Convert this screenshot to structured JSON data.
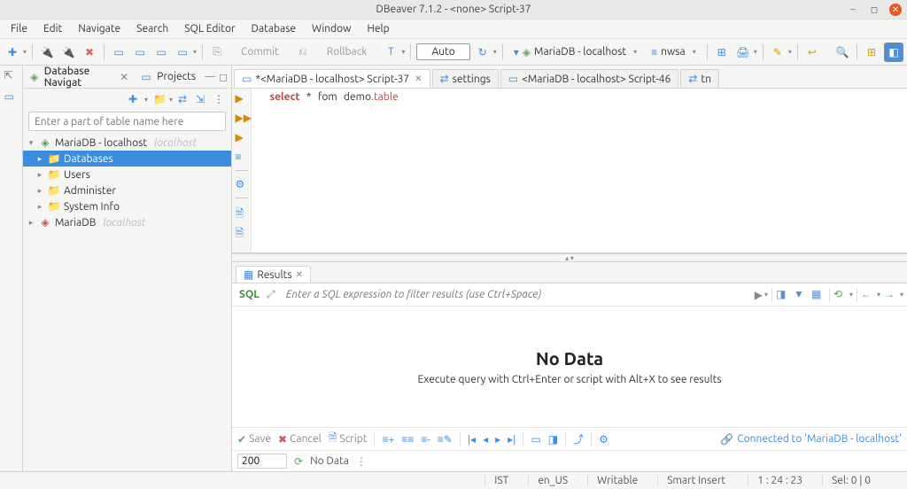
{
  "title": "DBeaver 7.1.2 - <none> Script-37",
  "menu": [
    "File",
    "Edit",
    "Navigate",
    "Search",
    "SQL Editor",
    "Database",
    "Window",
    "Help"
  ],
  "toolbar": {
    "commit": "Commit",
    "rollback": "Rollback",
    "auto": "Auto",
    "conn": "MariaDB - localhost",
    "db": "nwsa"
  },
  "nav": {
    "tab1": "Database Navigat",
    "tab2": "Projects",
    "filter_ph": "Enter a part of table name here",
    "root1": "MariaDB - localhost",
    "root1_hint": "localhost",
    "n_databases": "Databases",
    "n_users": "Users",
    "n_admin": "Administer",
    "n_sysinfo": "System Info",
    "root2": "MariaDB",
    "root2_hint": "localhost"
  },
  "editor": {
    "tabs": [
      "*<MariaDB - localhost> Script-37",
      "settings",
      "<MariaDB - localhost> Script-46",
      "tn"
    ],
    "sql": {
      "select": "select",
      "star": "*",
      "fom": "fom",
      "demo": "demo",
      "dot": ".",
      "table": "table"
    }
  },
  "results": {
    "tab": "Results",
    "sql_label": "SQL",
    "filter_ph": "Enter a SQL expression to filter results (use Ctrl+Space)",
    "nodata": "No Data",
    "nodata_sub": "Execute query with Ctrl+Enter or script with Alt+X to see results",
    "save": "Save",
    "cancel": "Cancel",
    "script": "Script",
    "conn": "Connected to 'MariaDB - localhost'",
    "limit": "200",
    "status": "No Data"
  },
  "status": {
    "ist": "IST",
    "loc": "en_US",
    "wr": "Writable",
    "ins": "Smart Insert",
    "pos": "1 : 24 : 23",
    "sel": "Sel: 0 | 0"
  }
}
